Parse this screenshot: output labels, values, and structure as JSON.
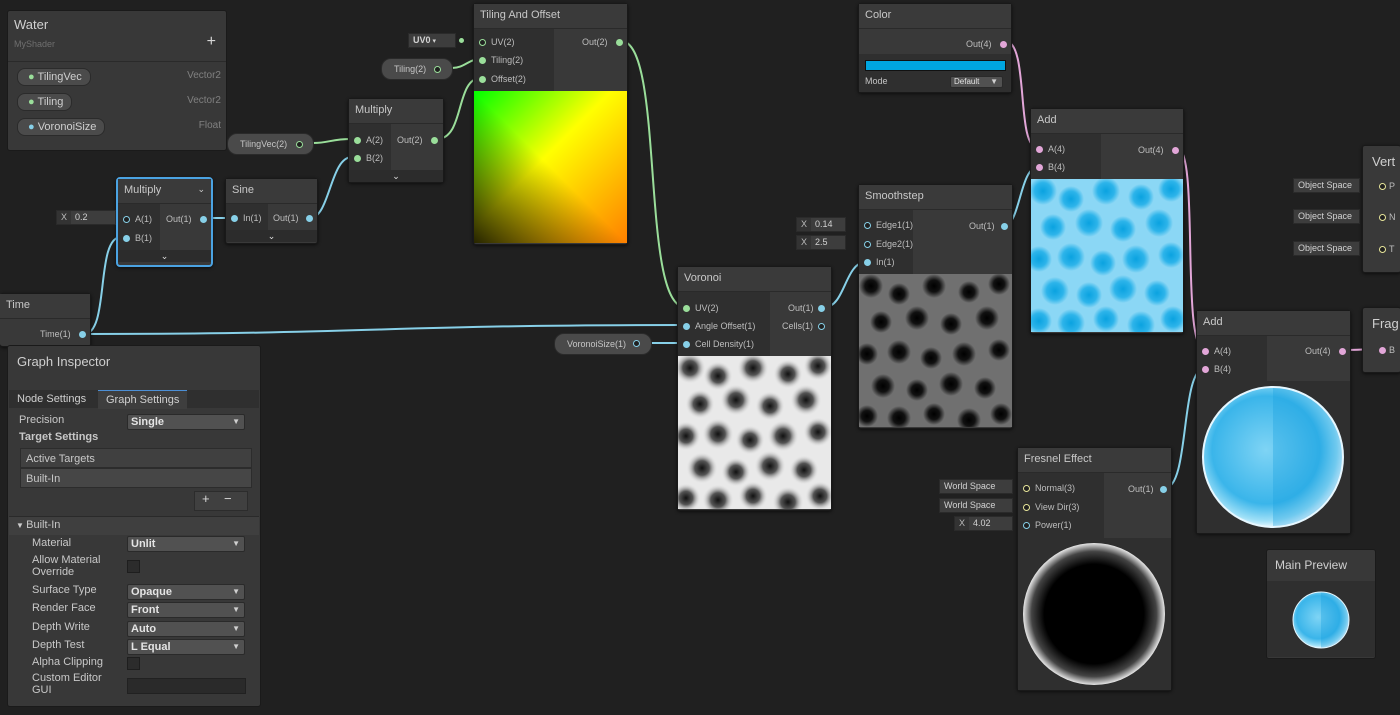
{
  "blackboard": {
    "title": "Water",
    "subtitle": "MyShader",
    "add_symbol": "+",
    "properties": [
      {
        "name": "TilingVec",
        "type": "Vector2"
      },
      {
        "name": "Tiling",
        "type": "Vector2"
      },
      {
        "name": "VoronoiSize",
        "type": "Float"
      }
    ]
  },
  "nodes": {
    "tiling_offset": {
      "title": "Tiling And Offset",
      "inputs": [
        "UV(2)",
        "Tiling(2)",
        "Offset(2)"
      ],
      "output": "Out(2)",
      "uv_dropdown": "UV0"
    },
    "color": {
      "title": "Color",
      "output": "Out(4)",
      "mode_label": "Mode",
      "mode_value": "Default",
      "swatch": "#00a6e0"
    },
    "multiply_top": {
      "title": "Multiply",
      "inputs": [
        "A(2)",
        "B(2)"
      ],
      "output": "Out(2)"
    },
    "multiply_sel": {
      "title": "Multiply",
      "inputs": [
        "A(1)",
        "B(1)"
      ],
      "output": "Out(1)",
      "x_label": "X",
      "x_value": "0.2"
    },
    "sine": {
      "title": "Sine",
      "input": "In(1)",
      "output": "Out(1)"
    },
    "time": {
      "title": "Time",
      "output": "Time(1)"
    },
    "voronoi": {
      "title": "Voronoi",
      "inputs": [
        "UV(2)",
        "Angle Offset(1)",
        "Cell Density(1)"
      ],
      "outputs": [
        "Out(1)",
        "Cells(1)"
      ]
    },
    "smoothstep": {
      "title": "Smoothstep",
      "inputs": [
        "Edge1(1)",
        "Edge2(1)",
        "In(1)"
      ],
      "output": "Out(1)",
      "edge1": "0.14",
      "edge2": "2.5",
      "x_label": "X"
    },
    "add1": {
      "title": "Add",
      "inputs": [
        "A(4)",
        "B(4)"
      ],
      "output": "Out(4)"
    },
    "add2": {
      "title": "Add",
      "inputs": [
        "A(4)",
        "B(4)"
      ],
      "output": "Out(4)"
    },
    "fresnel": {
      "title": "Fresnel Effect",
      "inputs": [
        "Normal(3)",
        "View Dir(3)",
        "Power(1)"
      ],
      "output": "Out(1)",
      "normal_space": "World Space",
      "view_space": "World Space",
      "x_label": "X",
      "power": "4.02"
    },
    "vertex": {
      "title": "Vert",
      "fields": [
        "Object Space",
        "Object Space",
        "Object Space"
      ],
      "port_letters": [
        "P",
        "N",
        "T"
      ]
    },
    "fragment": {
      "title": "Frag",
      "port_letter": "B"
    }
  },
  "property_nodes": {
    "tilingvec": "TilingVec(2)",
    "tiling": "Tiling(2)",
    "voronoisize": "VoronoiSize(1)"
  },
  "inspector": {
    "title": "Graph Inspector",
    "tabs": [
      "Node Settings",
      "Graph Settings"
    ],
    "precision_label": "Precision",
    "precision_value": "Single",
    "target_settings_label": "Target Settings",
    "active_targets_label": "Active Targets",
    "active_target_item": "Built-In",
    "list_add": "+",
    "list_remove": "−",
    "builtin_section": "Built-In",
    "material_label": "Material",
    "material_value": "Unlit",
    "allow_override_label": "Allow Material Override",
    "surface_type_label": "Surface Type",
    "surface_type_value": "Opaque",
    "render_face_label": "Render Face",
    "render_face_value": "Front",
    "depth_write_label": "Depth Write",
    "depth_write_value": "Auto",
    "depth_test_label": "Depth Test",
    "depth_test_value": "L Equal",
    "alpha_clipping_label": "Alpha Clipping",
    "custom_editor_label": "Custom Editor GUI"
  },
  "main_preview": {
    "title": "Main Preview"
  },
  "colors": {
    "background": "#202020",
    "wire_green": "#9ade9a",
    "wire_blue": "#87d0e8",
    "wire_pink": "#e2a6d8",
    "wire_yellow": "#e8e69a",
    "selection": "#4ba3e2",
    "water": "#00a6e0"
  }
}
